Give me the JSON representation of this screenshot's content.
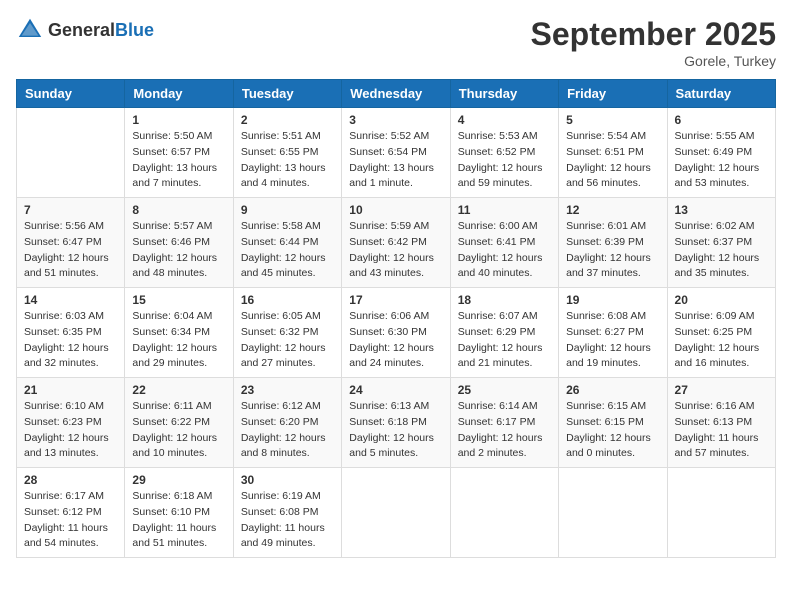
{
  "logo": {
    "general": "General",
    "blue": "Blue"
  },
  "title": "September 2025",
  "location": "Gorele, Turkey",
  "days_of_week": [
    "Sunday",
    "Monday",
    "Tuesday",
    "Wednesday",
    "Thursday",
    "Friday",
    "Saturday"
  ],
  "weeks": [
    [
      {
        "day": "",
        "info": ""
      },
      {
        "day": "1",
        "info": "Sunrise: 5:50 AM\nSunset: 6:57 PM\nDaylight: 13 hours\nand 7 minutes."
      },
      {
        "day": "2",
        "info": "Sunrise: 5:51 AM\nSunset: 6:55 PM\nDaylight: 13 hours\nand 4 minutes."
      },
      {
        "day": "3",
        "info": "Sunrise: 5:52 AM\nSunset: 6:54 PM\nDaylight: 13 hours\nand 1 minute."
      },
      {
        "day": "4",
        "info": "Sunrise: 5:53 AM\nSunset: 6:52 PM\nDaylight: 12 hours\nand 59 minutes."
      },
      {
        "day": "5",
        "info": "Sunrise: 5:54 AM\nSunset: 6:51 PM\nDaylight: 12 hours\nand 56 minutes."
      },
      {
        "day": "6",
        "info": "Sunrise: 5:55 AM\nSunset: 6:49 PM\nDaylight: 12 hours\nand 53 minutes."
      }
    ],
    [
      {
        "day": "7",
        "info": "Sunrise: 5:56 AM\nSunset: 6:47 PM\nDaylight: 12 hours\nand 51 minutes."
      },
      {
        "day": "8",
        "info": "Sunrise: 5:57 AM\nSunset: 6:46 PM\nDaylight: 12 hours\nand 48 minutes."
      },
      {
        "day": "9",
        "info": "Sunrise: 5:58 AM\nSunset: 6:44 PM\nDaylight: 12 hours\nand 45 minutes."
      },
      {
        "day": "10",
        "info": "Sunrise: 5:59 AM\nSunset: 6:42 PM\nDaylight: 12 hours\nand 43 minutes."
      },
      {
        "day": "11",
        "info": "Sunrise: 6:00 AM\nSunset: 6:41 PM\nDaylight: 12 hours\nand 40 minutes."
      },
      {
        "day": "12",
        "info": "Sunrise: 6:01 AM\nSunset: 6:39 PM\nDaylight: 12 hours\nand 37 minutes."
      },
      {
        "day": "13",
        "info": "Sunrise: 6:02 AM\nSunset: 6:37 PM\nDaylight: 12 hours\nand 35 minutes."
      }
    ],
    [
      {
        "day": "14",
        "info": "Sunrise: 6:03 AM\nSunset: 6:35 PM\nDaylight: 12 hours\nand 32 minutes."
      },
      {
        "day": "15",
        "info": "Sunrise: 6:04 AM\nSunset: 6:34 PM\nDaylight: 12 hours\nand 29 minutes."
      },
      {
        "day": "16",
        "info": "Sunrise: 6:05 AM\nSunset: 6:32 PM\nDaylight: 12 hours\nand 27 minutes."
      },
      {
        "day": "17",
        "info": "Sunrise: 6:06 AM\nSunset: 6:30 PM\nDaylight: 12 hours\nand 24 minutes."
      },
      {
        "day": "18",
        "info": "Sunrise: 6:07 AM\nSunset: 6:29 PM\nDaylight: 12 hours\nand 21 minutes."
      },
      {
        "day": "19",
        "info": "Sunrise: 6:08 AM\nSunset: 6:27 PM\nDaylight: 12 hours\nand 19 minutes."
      },
      {
        "day": "20",
        "info": "Sunrise: 6:09 AM\nSunset: 6:25 PM\nDaylight: 12 hours\nand 16 minutes."
      }
    ],
    [
      {
        "day": "21",
        "info": "Sunrise: 6:10 AM\nSunset: 6:23 PM\nDaylight: 12 hours\nand 13 minutes."
      },
      {
        "day": "22",
        "info": "Sunrise: 6:11 AM\nSunset: 6:22 PM\nDaylight: 12 hours\nand 10 minutes."
      },
      {
        "day": "23",
        "info": "Sunrise: 6:12 AM\nSunset: 6:20 PM\nDaylight: 12 hours\nand 8 minutes."
      },
      {
        "day": "24",
        "info": "Sunrise: 6:13 AM\nSunset: 6:18 PM\nDaylight: 12 hours\nand 5 minutes."
      },
      {
        "day": "25",
        "info": "Sunrise: 6:14 AM\nSunset: 6:17 PM\nDaylight: 12 hours\nand 2 minutes."
      },
      {
        "day": "26",
        "info": "Sunrise: 6:15 AM\nSunset: 6:15 PM\nDaylight: 12 hours\nand 0 minutes."
      },
      {
        "day": "27",
        "info": "Sunrise: 6:16 AM\nSunset: 6:13 PM\nDaylight: 11 hours\nand 57 minutes."
      }
    ],
    [
      {
        "day": "28",
        "info": "Sunrise: 6:17 AM\nSunset: 6:12 PM\nDaylight: 11 hours\nand 54 minutes."
      },
      {
        "day": "29",
        "info": "Sunrise: 6:18 AM\nSunset: 6:10 PM\nDaylight: 11 hours\nand 51 minutes."
      },
      {
        "day": "30",
        "info": "Sunrise: 6:19 AM\nSunset: 6:08 PM\nDaylight: 11 hours\nand 49 minutes."
      },
      {
        "day": "",
        "info": ""
      },
      {
        "day": "",
        "info": ""
      },
      {
        "day": "",
        "info": ""
      },
      {
        "day": "",
        "info": ""
      }
    ]
  ]
}
